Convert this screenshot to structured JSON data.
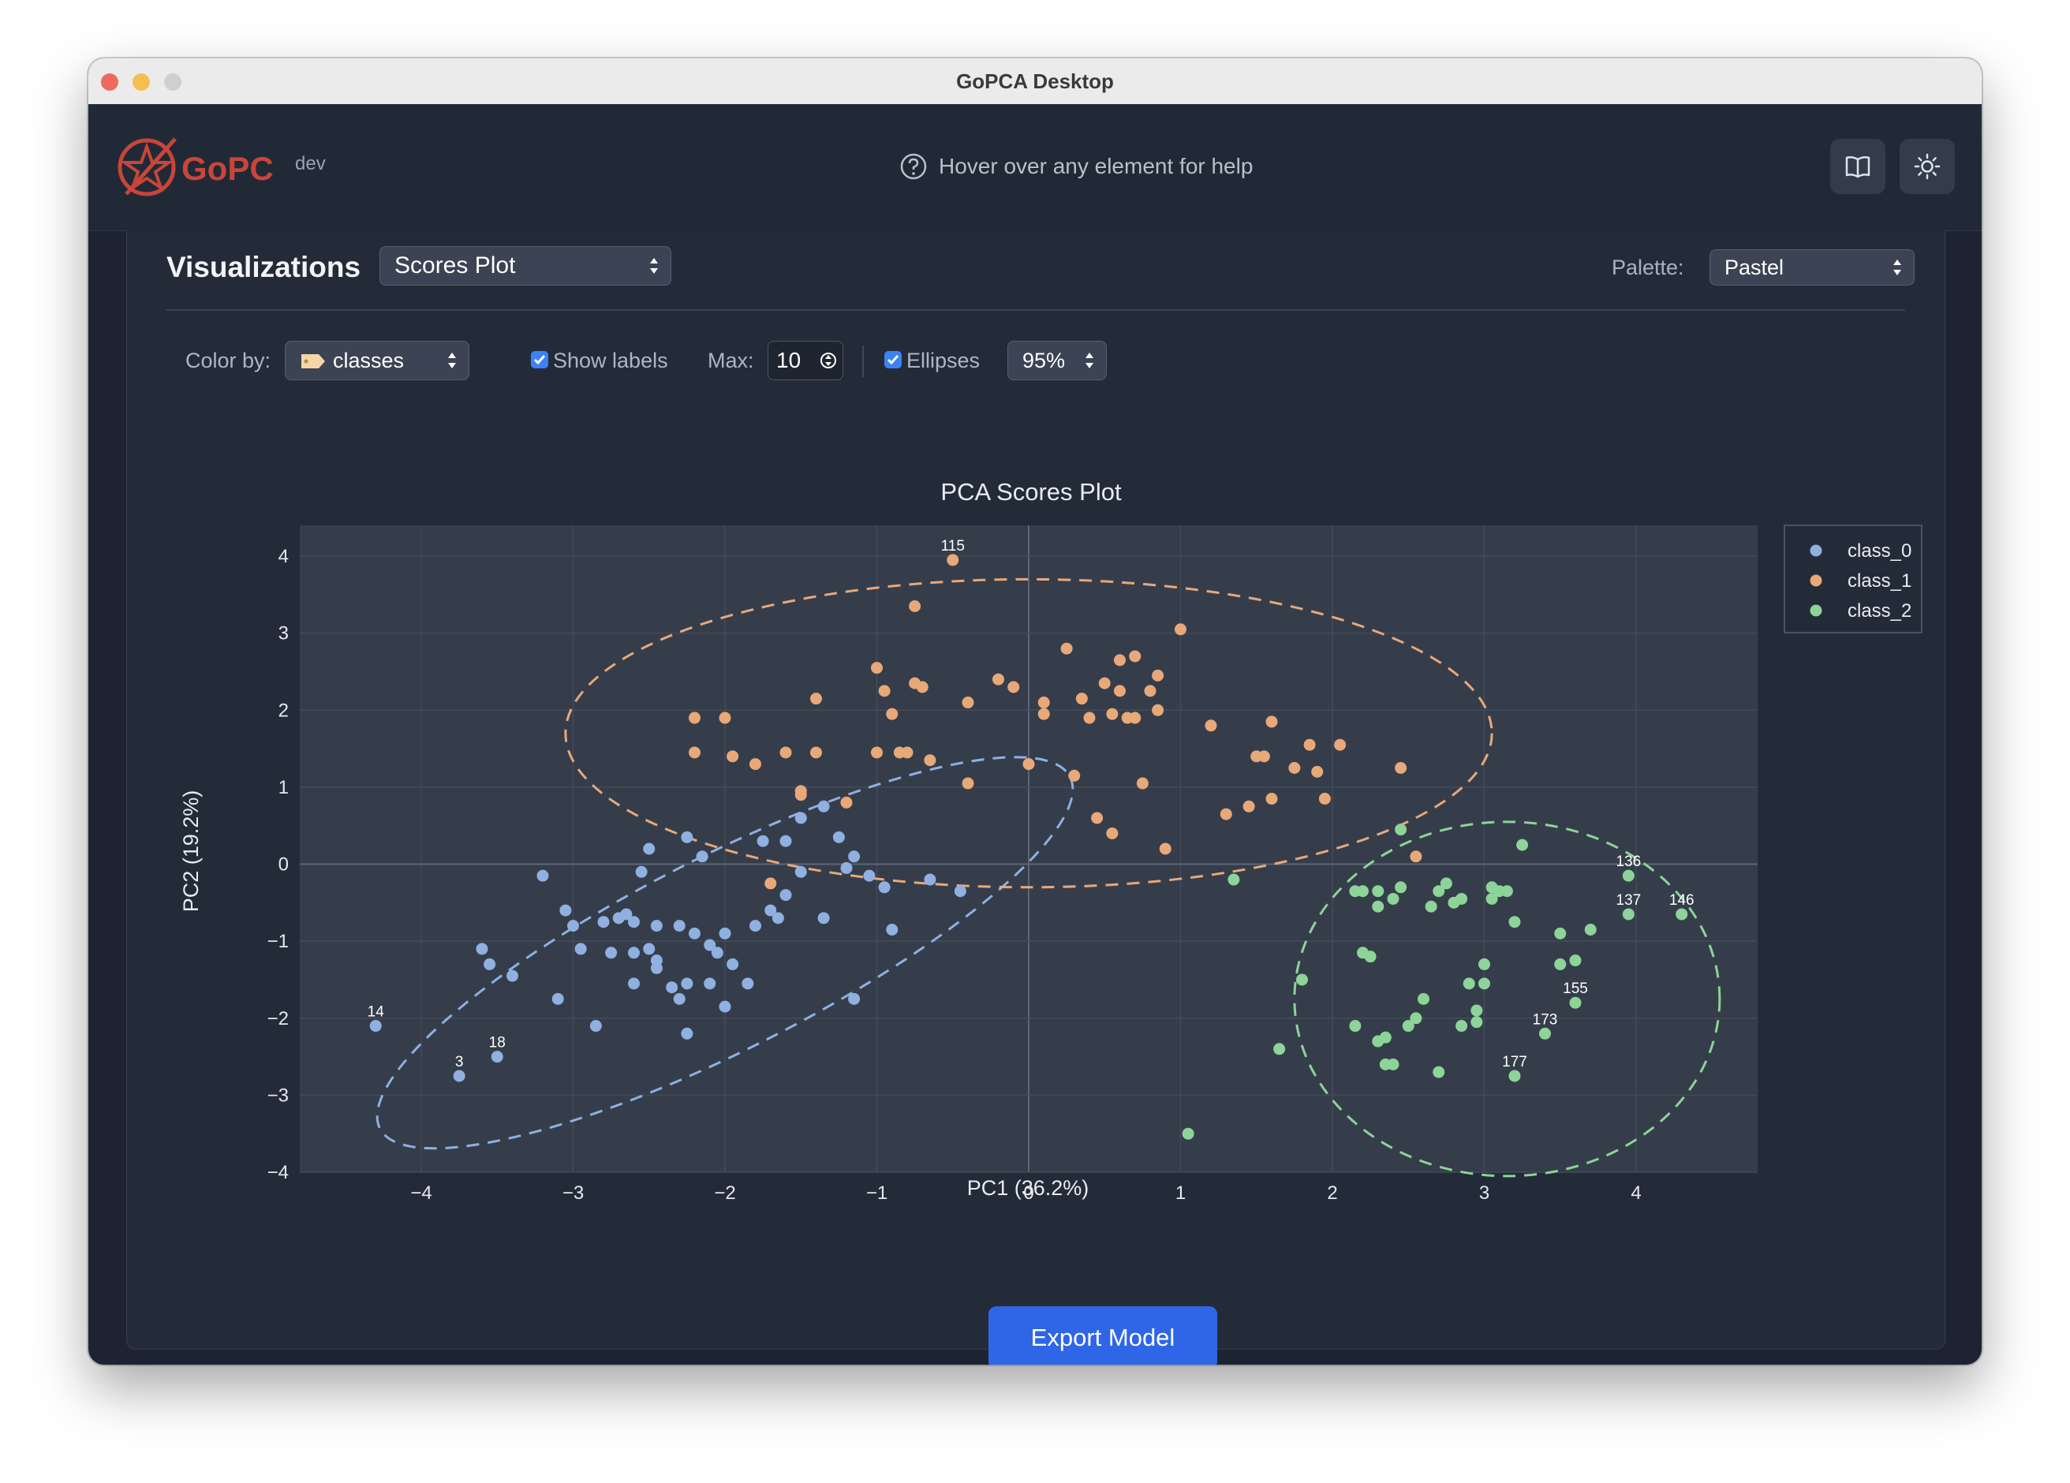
{
  "window": {
    "title": "GoPCA Desktop"
  },
  "header": {
    "logo_text": "GoPCA",
    "version": "dev",
    "help_text": "Hover over any element for help",
    "icons": [
      "book-icon",
      "sun-icon"
    ]
  },
  "visualizations": {
    "title": "Visualizations",
    "plot_type": "Scores Plot",
    "palette_label": "Palette:",
    "palette_value": "Pastel"
  },
  "controls": {
    "color_by_label": "Color by:",
    "color_by_value": "classes",
    "show_labels_label": "Show labels",
    "show_labels_checked": true,
    "max_label": "Max:",
    "max_value": "10",
    "ellipses_label": "Ellipses",
    "ellipses_checked": true,
    "confidence_value": "95%"
  },
  "chart_data": {
    "type": "scatter",
    "title": "PCA Scores Plot",
    "xlabel": "PC1 (36.2%)",
    "ylabel": "PC2 (19.2%)",
    "xlim": [
      -4.8,
      4.8
    ],
    "ylim": [
      -4,
      4.4
    ],
    "xticks": [
      "−4",
      "−3",
      "−2",
      "−1",
      "0",
      "1",
      "2",
      "3",
      "4"
    ],
    "yticks": [
      "4",
      "3",
      "2",
      "1",
      "0",
      "−1",
      "−2",
      "−3",
      "−4"
    ],
    "grid": true,
    "legend_position": "top-right outside",
    "series": [
      {
        "name": "class_0",
        "color": "#8fb0e0",
        "points": [
          [
            -4.3,
            -2.1
          ],
          [
            -3.75,
            -2.75
          ],
          [
            -3.5,
            -2.5
          ],
          [
            -3.2,
            -0.15
          ],
          [
            -3.0,
            -0.8
          ],
          [
            -2.95,
            -1.1
          ],
          [
            -2.85,
            -2.1
          ],
          [
            -3.6,
            -1.1
          ],
          [
            -3.55,
            -1.3
          ],
          [
            -3.4,
            -1.45
          ],
          [
            -3.1,
            -1.75
          ],
          [
            -2.7,
            -0.7
          ],
          [
            -2.65,
            -0.65
          ],
          [
            -2.6,
            -0.75
          ],
          [
            -2.5,
            -1.1
          ],
          [
            -2.45,
            -1.35
          ],
          [
            -2.3,
            -1.75
          ],
          [
            -2.45,
            -0.8
          ],
          [
            -2.3,
            -0.8
          ],
          [
            -2.2,
            -0.9
          ],
          [
            -2.1,
            -1.05
          ],
          [
            -2.05,
            -1.15
          ],
          [
            -2.1,
            -1.55
          ],
          [
            -2.0,
            -0.9
          ],
          [
            -1.95,
            -1.3
          ],
          [
            -1.85,
            -1.55
          ],
          [
            -1.8,
            -0.8
          ],
          [
            -2.25,
            -1.55
          ],
          [
            -2.0,
            -1.85
          ],
          [
            -1.7,
            -0.6
          ],
          [
            -1.6,
            -0.4
          ],
          [
            -1.5,
            -0.1
          ],
          [
            -1.6,
            0.3
          ],
          [
            -1.5,
            0.6
          ],
          [
            -1.35,
            0.75
          ],
          [
            -1.25,
            0.35
          ],
          [
            -1.15,
            0.1
          ],
          [
            -1.05,
            -0.15
          ],
          [
            -0.95,
            -0.3
          ],
          [
            -0.9,
            -0.85
          ],
          [
            -1.2,
            -0.05
          ],
          [
            -0.65,
            -0.2
          ],
          [
            -0.45,
            -0.35
          ],
          [
            -2.25,
            -2.2
          ],
          [
            -1.15,
            -1.75
          ],
          [
            -2.55,
            -0.1
          ],
          [
            -2.5,
            0.2
          ],
          [
            -2.15,
            0.1
          ],
          [
            -2.25,
            0.35
          ],
          [
            -1.75,
            0.3
          ],
          [
            -2.8,
            -0.75
          ],
          [
            -2.6,
            -1.15
          ],
          [
            -2.35,
            -1.6
          ],
          [
            -2.75,
            -1.15
          ],
          [
            -2.6,
            -1.55
          ],
          [
            -3.05,
            -0.6
          ],
          [
            -1.35,
            -0.7
          ],
          [
            -1.65,
            -0.7
          ],
          [
            -2.45,
            -1.25
          ]
        ],
        "labels": [
          {
            "x": -4.3,
            "y": -2.1,
            "text": "14"
          },
          {
            "x": -3.75,
            "y": -2.75,
            "text": "3"
          },
          {
            "x": -3.5,
            "y": -2.5,
            "text": "18"
          }
        ],
        "ellipse": {
          "cx": -2.0,
          "cy": -1.15,
          "rx": 2.55,
          "ry": 1.25,
          "angle_deg": 27
        }
      },
      {
        "name": "class_1",
        "color": "#e8a878",
        "points": [
          [
            -0.5,
            3.95
          ],
          [
            -0.75,
            3.35
          ],
          [
            -2.2,
            1.9
          ],
          [
            -2.0,
            1.9
          ],
          [
            -2.2,
            1.45
          ],
          [
            -1.95,
            1.4
          ],
          [
            -1.8,
            1.3
          ],
          [
            -1.6,
            1.45
          ],
          [
            -1.4,
            1.45
          ],
          [
            -1.4,
            2.15
          ],
          [
            -1.0,
            2.55
          ],
          [
            -0.95,
            2.25
          ],
          [
            -0.9,
            1.95
          ],
          [
            -1.0,
            1.45
          ],
          [
            -0.85,
            1.45
          ],
          [
            -0.8,
            1.45
          ],
          [
            -0.75,
            2.35
          ],
          [
            -0.7,
            2.3
          ],
          [
            -0.65,
            1.35
          ],
          [
            -0.4,
            2.1
          ],
          [
            -0.4,
            1.05
          ],
          [
            -0.2,
            2.4
          ],
          [
            -0.1,
            2.3
          ],
          [
            0.0,
            1.3
          ],
          [
            0.1,
            2.1
          ],
          [
            0.1,
            1.95
          ],
          [
            0.25,
            2.8
          ],
          [
            0.35,
            2.15
          ],
          [
            0.4,
            1.9
          ],
          [
            0.5,
            2.35
          ],
          [
            0.55,
            1.95
          ],
          [
            0.6,
            2.65
          ],
          [
            0.6,
            2.25
          ],
          [
            0.65,
            1.9
          ],
          [
            0.7,
            2.7
          ],
          [
            0.8,
            2.25
          ],
          [
            0.85,
            2.45
          ],
          [
            1.0,
            3.05
          ],
          [
            0.75,
            1.05
          ],
          [
            0.9,
            0.2
          ],
          [
            1.2,
            1.8
          ],
          [
            1.3,
            0.65
          ],
          [
            1.45,
            0.75
          ],
          [
            1.5,
            1.4
          ],
          [
            1.55,
            1.4
          ],
          [
            1.6,
            1.85
          ],
          [
            1.6,
            0.85
          ],
          [
            1.75,
            1.25
          ],
          [
            1.85,
            1.55
          ],
          [
            1.9,
            1.2
          ],
          [
            1.95,
            0.85
          ],
          [
            2.05,
            1.55
          ],
          [
            2.45,
            1.25
          ],
          [
            2.55,
            0.1
          ],
          [
            -1.5,
            0.95
          ],
          [
            -1.7,
            -0.25
          ],
          [
            -1.5,
            0.9
          ],
          [
            0.55,
            0.4
          ],
          [
            0.3,
            1.15
          ],
          [
            0.45,
            0.6
          ],
          [
            0.85,
            2.0
          ],
          [
            0.7,
            1.9
          ],
          [
            -1.2,
            0.8
          ]
        ],
        "labels": [
          {
            "x": -0.5,
            "y": 3.95,
            "text": "115"
          }
        ],
        "ellipse": {
          "cx": 0.0,
          "cy": 1.7,
          "rx": 3.05,
          "ry": 2.0,
          "angle_deg": 0
        }
      },
      {
        "name": "class_2",
        "color": "#8cd497",
        "points": [
          [
            1.05,
            -3.5
          ],
          [
            1.35,
            -0.2
          ],
          [
            1.65,
            -2.4
          ],
          [
            1.8,
            -1.5
          ],
          [
            2.15,
            -0.35
          ],
          [
            2.15,
            -2.1
          ],
          [
            2.2,
            -1.15
          ],
          [
            2.25,
            -1.2
          ],
          [
            2.3,
            -0.35
          ],
          [
            2.3,
            -2.3
          ],
          [
            2.35,
            -2.6
          ],
          [
            2.4,
            -2.6
          ],
          [
            2.35,
            -2.25
          ],
          [
            2.4,
            -0.45
          ],
          [
            2.45,
            -0.3
          ],
          [
            2.45,
            0.45
          ],
          [
            2.5,
            -2.1
          ],
          [
            2.55,
            -2.0
          ],
          [
            2.6,
            -1.75
          ],
          [
            2.65,
            -0.55
          ],
          [
            2.7,
            -0.35
          ],
          [
            2.75,
            -0.25
          ],
          [
            2.8,
            -0.5
          ],
          [
            2.85,
            -0.45
          ],
          [
            2.85,
            -2.1
          ],
          [
            2.7,
            -2.7
          ],
          [
            2.9,
            -1.55
          ],
          [
            2.95,
            -1.9
          ],
          [
            2.95,
            -2.05
          ],
          [
            3.0,
            -1.3
          ],
          [
            3.0,
            -1.55
          ],
          [
            3.05,
            -0.3
          ],
          [
            3.05,
            -0.45
          ],
          [
            3.1,
            -0.35
          ],
          [
            3.15,
            -0.35
          ],
          [
            3.2,
            -0.75
          ],
          [
            3.25,
            0.25
          ],
          [
            3.2,
            -2.75
          ],
          [
            3.4,
            -2.2
          ],
          [
            3.5,
            -1.3
          ],
          [
            3.5,
            -0.9
          ],
          [
            3.6,
            -1.25
          ],
          [
            3.6,
            -1.8
          ],
          [
            3.7,
            -0.85
          ],
          [
            3.95,
            -0.15
          ],
          [
            3.95,
            -0.65
          ],
          [
            4.3,
            -0.65
          ],
          [
            2.2,
            -0.35
          ],
          [
            2.3,
            -0.55
          ]
        ],
        "labels": [
          {
            "x": 3.95,
            "y": -0.15,
            "text": "136"
          },
          {
            "x": 3.95,
            "y": -0.65,
            "text": "137"
          },
          {
            "x": 4.3,
            "y": -0.65,
            "text": "146"
          },
          {
            "x": 3.6,
            "y": -1.8,
            "text": "155"
          },
          {
            "x": 3.4,
            "y": -2.2,
            "text": "173"
          },
          {
            "x": 3.2,
            "y": -2.75,
            "text": "177"
          }
        ],
        "ellipse": {
          "cx": 3.15,
          "cy": -1.75,
          "rx": 1.4,
          "ry": 2.3,
          "angle_deg": 0
        }
      }
    ]
  },
  "footer": {
    "export_label": "Export Model"
  }
}
